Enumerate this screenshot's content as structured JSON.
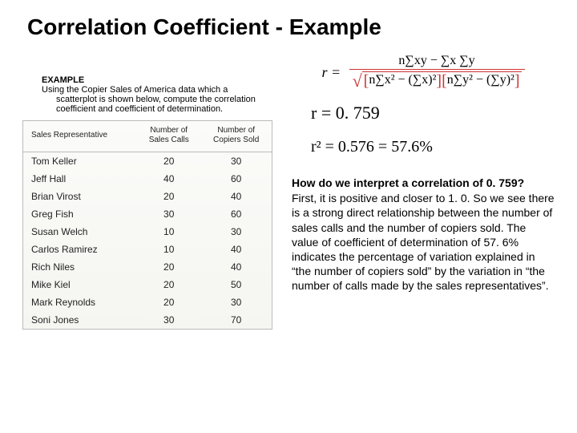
{
  "title": "Correlation Coefficient - Example",
  "example": {
    "heading": "EXAMPLE",
    "body": "Using the Copier Sales of America data  which a scatterplot is shown below, compute the correlation coefficient and coefficient of determination."
  },
  "table": {
    "headers": [
      "Sales Representative",
      "Number of\nSales Calls",
      "Number of\nCopiers Sold"
    ],
    "rows": [
      [
        "Tom Keller",
        "20",
        "30"
      ],
      [
        "Jeff Hall",
        "40",
        "60"
      ],
      [
        "Brian Virost",
        "20",
        "40"
      ],
      [
        "Greg Fish",
        "30",
        "60"
      ],
      [
        "Susan Welch",
        "10",
        "30"
      ],
      [
        "Carlos Ramirez",
        "10",
        "40"
      ],
      [
        "Rich Niles",
        "20",
        "40"
      ],
      [
        "Mike Kiel",
        "20",
        "50"
      ],
      [
        "Mark Reynolds",
        "20",
        "30"
      ],
      [
        "Soni Jones",
        "30",
        "70"
      ]
    ]
  },
  "formula": {
    "lhs": "r =",
    "numerator": "n∑xy − ∑x ∑y",
    "den_left": "n∑x² − (∑x)²",
    "den_right": "n∑y² − (∑y)²"
  },
  "r_value": "r = 0. 759",
  "r2_value": "r² = 0.576 = 57.6%",
  "interpretation": {
    "heading": "How do we interpret a correlation of 0. 759?",
    "body": "First, it is positive and closer to 1. 0. So we see there is a strong direct relationship between the number of sales calls and the number of copiers sold. The value of coefficient of determination of 57. 6% indicates the percentage of variation explained in “the number of copiers sold” by the variation in “the number of calls made by the sales representatives”."
  }
}
